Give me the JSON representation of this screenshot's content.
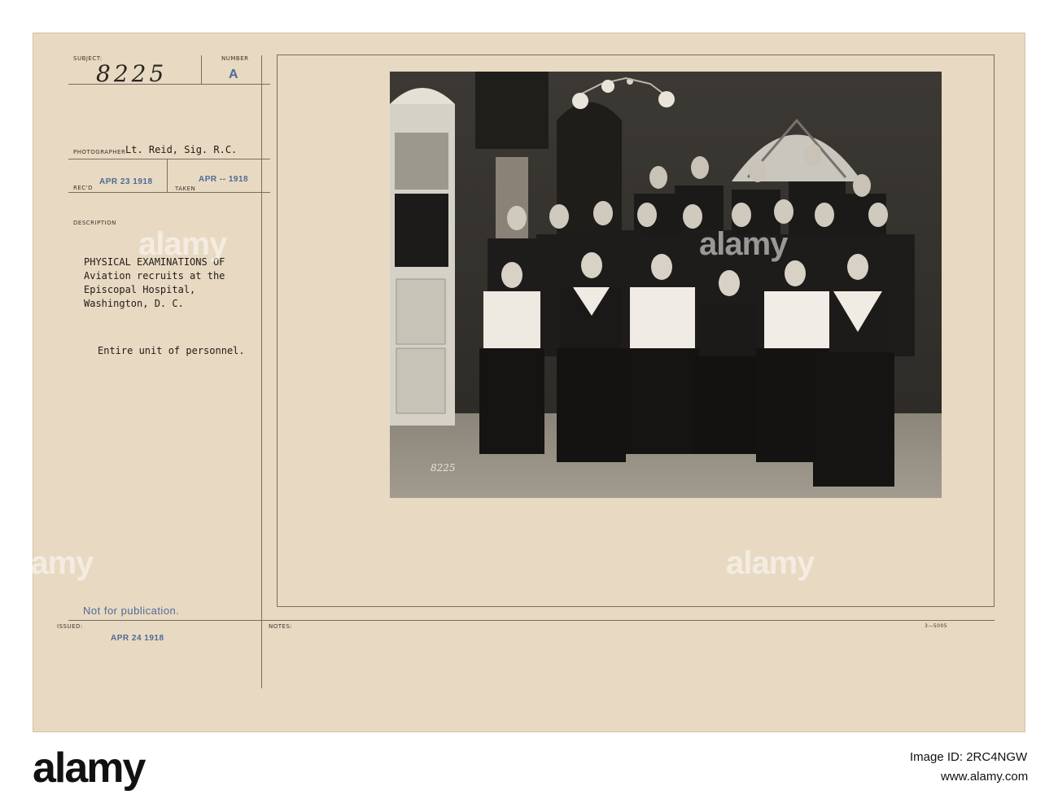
{
  "card": {
    "subject_label": "SUBJECT:",
    "subject_value": "8225",
    "number_label": "NUMBER",
    "number_value": "A",
    "photographer_label": "PHOTOGRAPHER",
    "photographer_value": "Lt. Reid, Sig. R.C.",
    "recd_stamp": "APR 23 1918",
    "recd_label": "REC'D",
    "taken_stamp": "APR -- 1918",
    "taken_label": "TAKEN",
    "description_label": "DESCRIPTION",
    "description_lines": [
      "PHYSICAL EXAMINATIONS OF",
      "Aviation recruits at the",
      "Episcopal Hospital,",
      "Washington, D. C."
    ],
    "description_note": "Entire unit of personnel.",
    "not_for_publication": "Not for publication.",
    "issued_label": "ISSUED:",
    "issued_stamp": "APR 24 1918",
    "notes_label": "NOTES:",
    "form_number": "3—5005"
  },
  "photo": {
    "negative_number": "8225",
    "watermark_text": "alamy"
  },
  "footer": {
    "logo_text": "alamy",
    "image_id_label": "Image ID: 2RC4NGW",
    "website": "www.alamy.com"
  },
  "colors": {
    "card": "#e8d9c2",
    "stamp": "#4f6a96",
    "photo_dark": "#2a2825"
  }
}
